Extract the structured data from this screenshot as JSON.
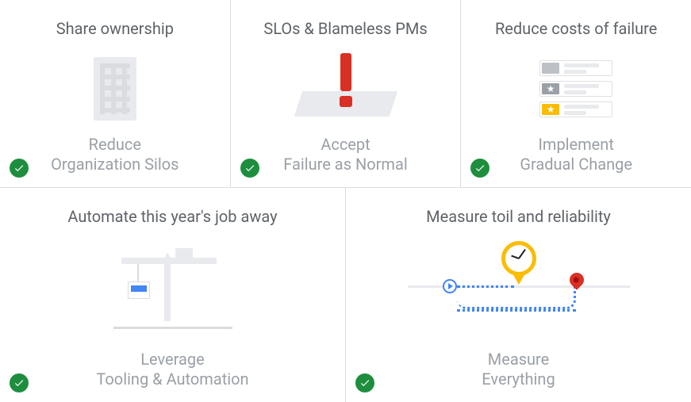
{
  "row1": [
    {
      "title": "Share ownership",
      "sub1": "Reduce",
      "sub2": "Organization Silos"
    },
    {
      "title": "SLOs & Blameless PMs",
      "sub1": "Accept",
      "sub2": "Failure as Normal"
    },
    {
      "title": "Reduce costs of failure",
      "sub1": "Implement",
      "sub2": "Gradual Change"
    }
  ],
  "row2": [
    {
      "title": "Automate this year's job away",
      "sub1": "Leverage",
      "sub2": "Tooling & Automation"
    },
    {
      "title": "Measure toil and reliability",
      "sub1": "Measure",
      "sub2": "Everything"
    }
  ]
}
